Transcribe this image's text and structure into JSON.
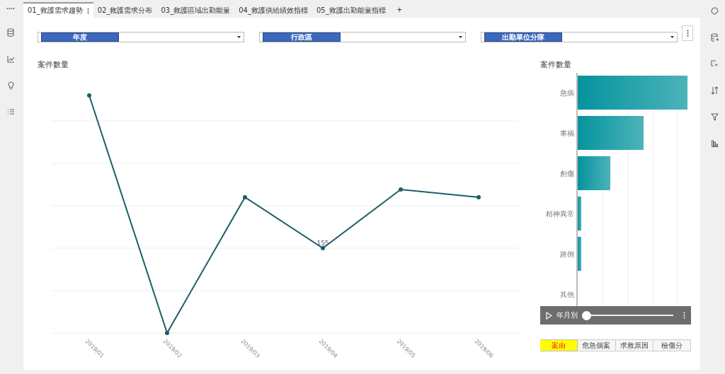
{
  "tabs": [
    {
      "label": "01_救護需求趨勢",
      "selected": true
    },
    {
      "label": "02_救護需求分布",
      "selected": false
    },
    {
      "label": "03_救護區域出勤能量",
      "selected": false
    },
    {
      "label": "04_救護供給績效指標",
      "selected": false
    },
    {
      "label": "05_救護出勤能量指標",
      "selected": false
    }
  ],
  "tab_add": "+",
  "filters": [
    {
      "label": "年度"
    },
    {
      "label": "行政區"
    },
    {
      "label": "出勤單位分隊"
    }
  ],
  "line_chart": {
    "title": "案件數量",
    "points": [
      {
        "label": "2019/01"
      },
      {
        "label": "2019/02"
      },
      {
        "label": "2019/03"
      },
      {
        "label": "2019/04",
        "value_label": "155"
      },
      {
        "label": "2019/05"
      },
      {
        "label": "2019/06"
      }
    ]
  },
  "bar_chart": {
    "title": "案件數量",
    "categories": [
      "急病",
      "車禍",
      "創傷",
      "精神異常",
      "路倒",
      "其他"
    ]
  },
  "player": {
    "label": "年月別",
    "level": 0
  },
  "view_buttons": [
    {
      "label": "案由",
      "selected": true
    },
    {
      "label": "危急個案",
      "selected": false
    },
    {
      "label": "求救原因",
      "selected": false
    },
    {
      "label": "檢傷分",
      "selected": false
    }
  ]
}
